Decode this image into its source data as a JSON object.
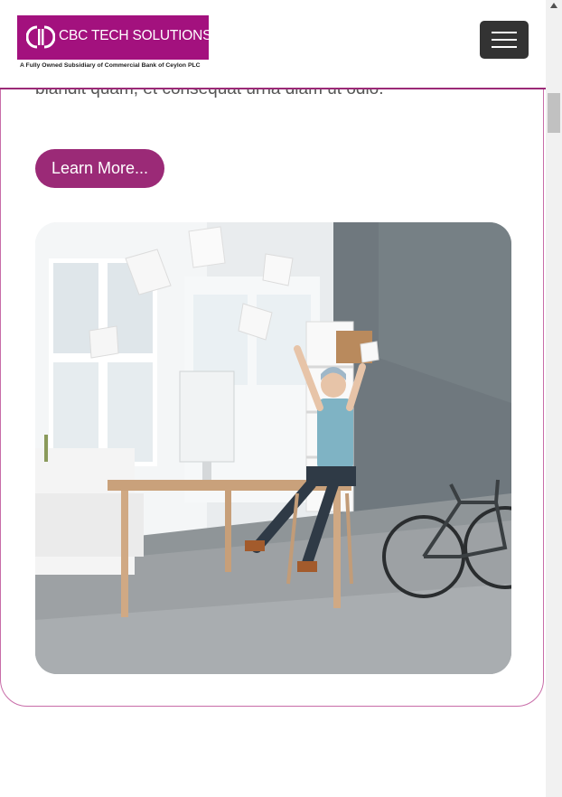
{
  "header": {
    "logo": {
      "name": "CBC TECH SOLUTIONS",
      "tagline": "A Fully Owned Subsidiary of Commercial Bank of Ceylon PLC"
    },
    "menu_icon": "hamburger-menu-icon"
  },
  "content": {
    "paragraph_tail": "blandit quam, et consequat urna diam ut odio.",
    "learn_more_label": "Learn More...",
    "image_subject": "office-worker-throwing-papers"
  },
  "colors": {
    "brand": "#a3117e",
    "button": "#9b2a77",
    "border": "#c86ca8",
    "menu_button": "#333333"
  },
  "scrollbar": {
    "up_arrow_icon": "scroll-up-arrow-icon"
  }
}
